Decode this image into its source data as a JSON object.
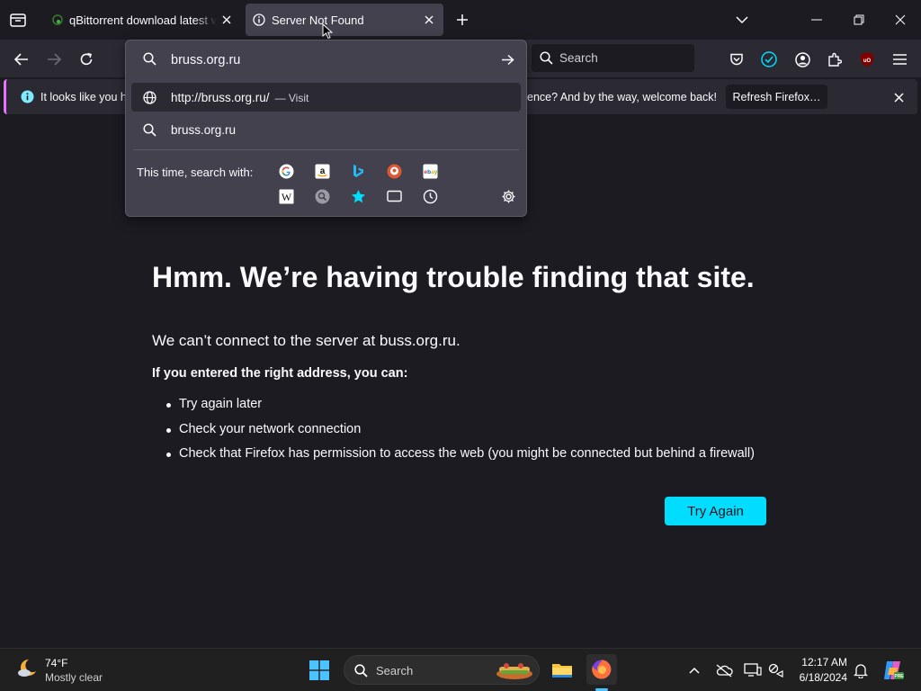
{
  "tabs": [
    {
      "title": "qBittorrent download latest version",
      "active": false,
      "icon": "qbittorrent-icon"
    },
    {
      "title": "Server Not Found",
      "active": true,
      "icon": "info-icon"
    }
  ],
  "navbar": {
    "search_placeholder": "Search"
  },
  "notification": {
    "text_left": "It looks like you ha",
    "text_right": "ence? And by the way, welcome back!",
    "button_label": "Refresh Firefox…"
  },
  "url_dropdown": {
    "input_value": "bruss.org.ru",
    "suggestions": [
      {
        "label": "http://bruss.org.ru/",
        "action": "— Visit",
        "icon": "globe-icon",
        "selected": true
      },
      {
        "label": "bruss.org.ru",
        "action": "",
        "icon": "search-icon",
        "selected": false
      }
    ],
    "search_with_label": "This time, search with:",
    "engines": [
      "google",
      "amazon",
      "bing",
      "duckduckgo",
      "ebay",
      "wikipedia",
      "search-engine",
      "bookmarks",
      "tabs",
      "history"
    ]
  },
  "error_page": {
    "title": "Hmm. We’re having trouble finding that site.",
    "description": "We can’t connect to the server at buss.org.ru.",
    "hint": "If you entered the right address, you can:",
    "suggestions": [
      "Try again later",
      "Check your network connection",
      "Check that Firefox has permission to access the web (you might be connected but behind a firewall)"
    ],
    "button_label": "Try Again"
  },
  "taskbar": {
    "weather_temp": "74°F",
    "weather_desc": "Mostly clear",
    "search_placeholder": "Search",
    "time": "12:17 AM",
    "date": "6/18/2024"
  },
  "colors": {
    "accent": "#00ddff",
    "page_bg": "#1c1b22",
    "toolbar_bg": "#2b2a33",
    "panel_bg": "#42414d"
  }
}
